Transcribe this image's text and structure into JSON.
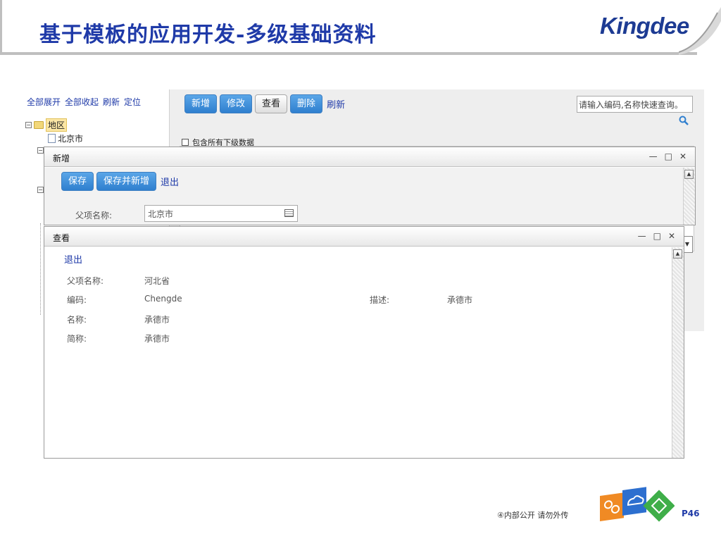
{
  "slide": {
    "title": "基于模板的应用开发-多级基础资料",
    "logo_text": "Kingdee",
    "footer_note": "④内部公开 请勿外传",
    "page_number": "P46"
  },
  "tree": {
    "links": [
      "全部展开",
      "全部收起",
      "刷新",
      "定位"
    ],
    "root_label": "地区",
    "child_label": "北京市"
  },
  "toolbar": {
    "new": "新增",
    "edit": "修改",
    "view": "查看",
    "delete": "删除",
    "refresh": "刷新"
  },
  "search": {
    "value": "请输入编码,名称快速查询。"
  },
  "include_sub_label": "包含所有下级数据",
  "dialog_new": {
    "title": "新增",
    "save": "保存",
    "save_new": "保存并新增",
    "exit": "退出",
    "parent_label": "父项名称:",
    "parent_value": "北京市"
  },
  "dialog_view": {
    "title": "查看",
    "exit": "退出",
    "parent_label": "父项名称:",
    "parent_value": "河北省",
    "code_label": "编码:",
    "code_value": "Chengde",
    "desc_label": "描述:",
    "desc_value": "承德市",
    "name_label": "名称:",
    "name_value": "承德市",
    "short_label": "简称:",
    "short_value": "承德市"
  },
  "window_controls": {
    "minimize": "—",
    "maximize": "□",
    "close": "✕"
  },
  "colors": {
    "title_blue": "#1f3aa8",
    "button_blue": "#2f7fcf"
  }
}
